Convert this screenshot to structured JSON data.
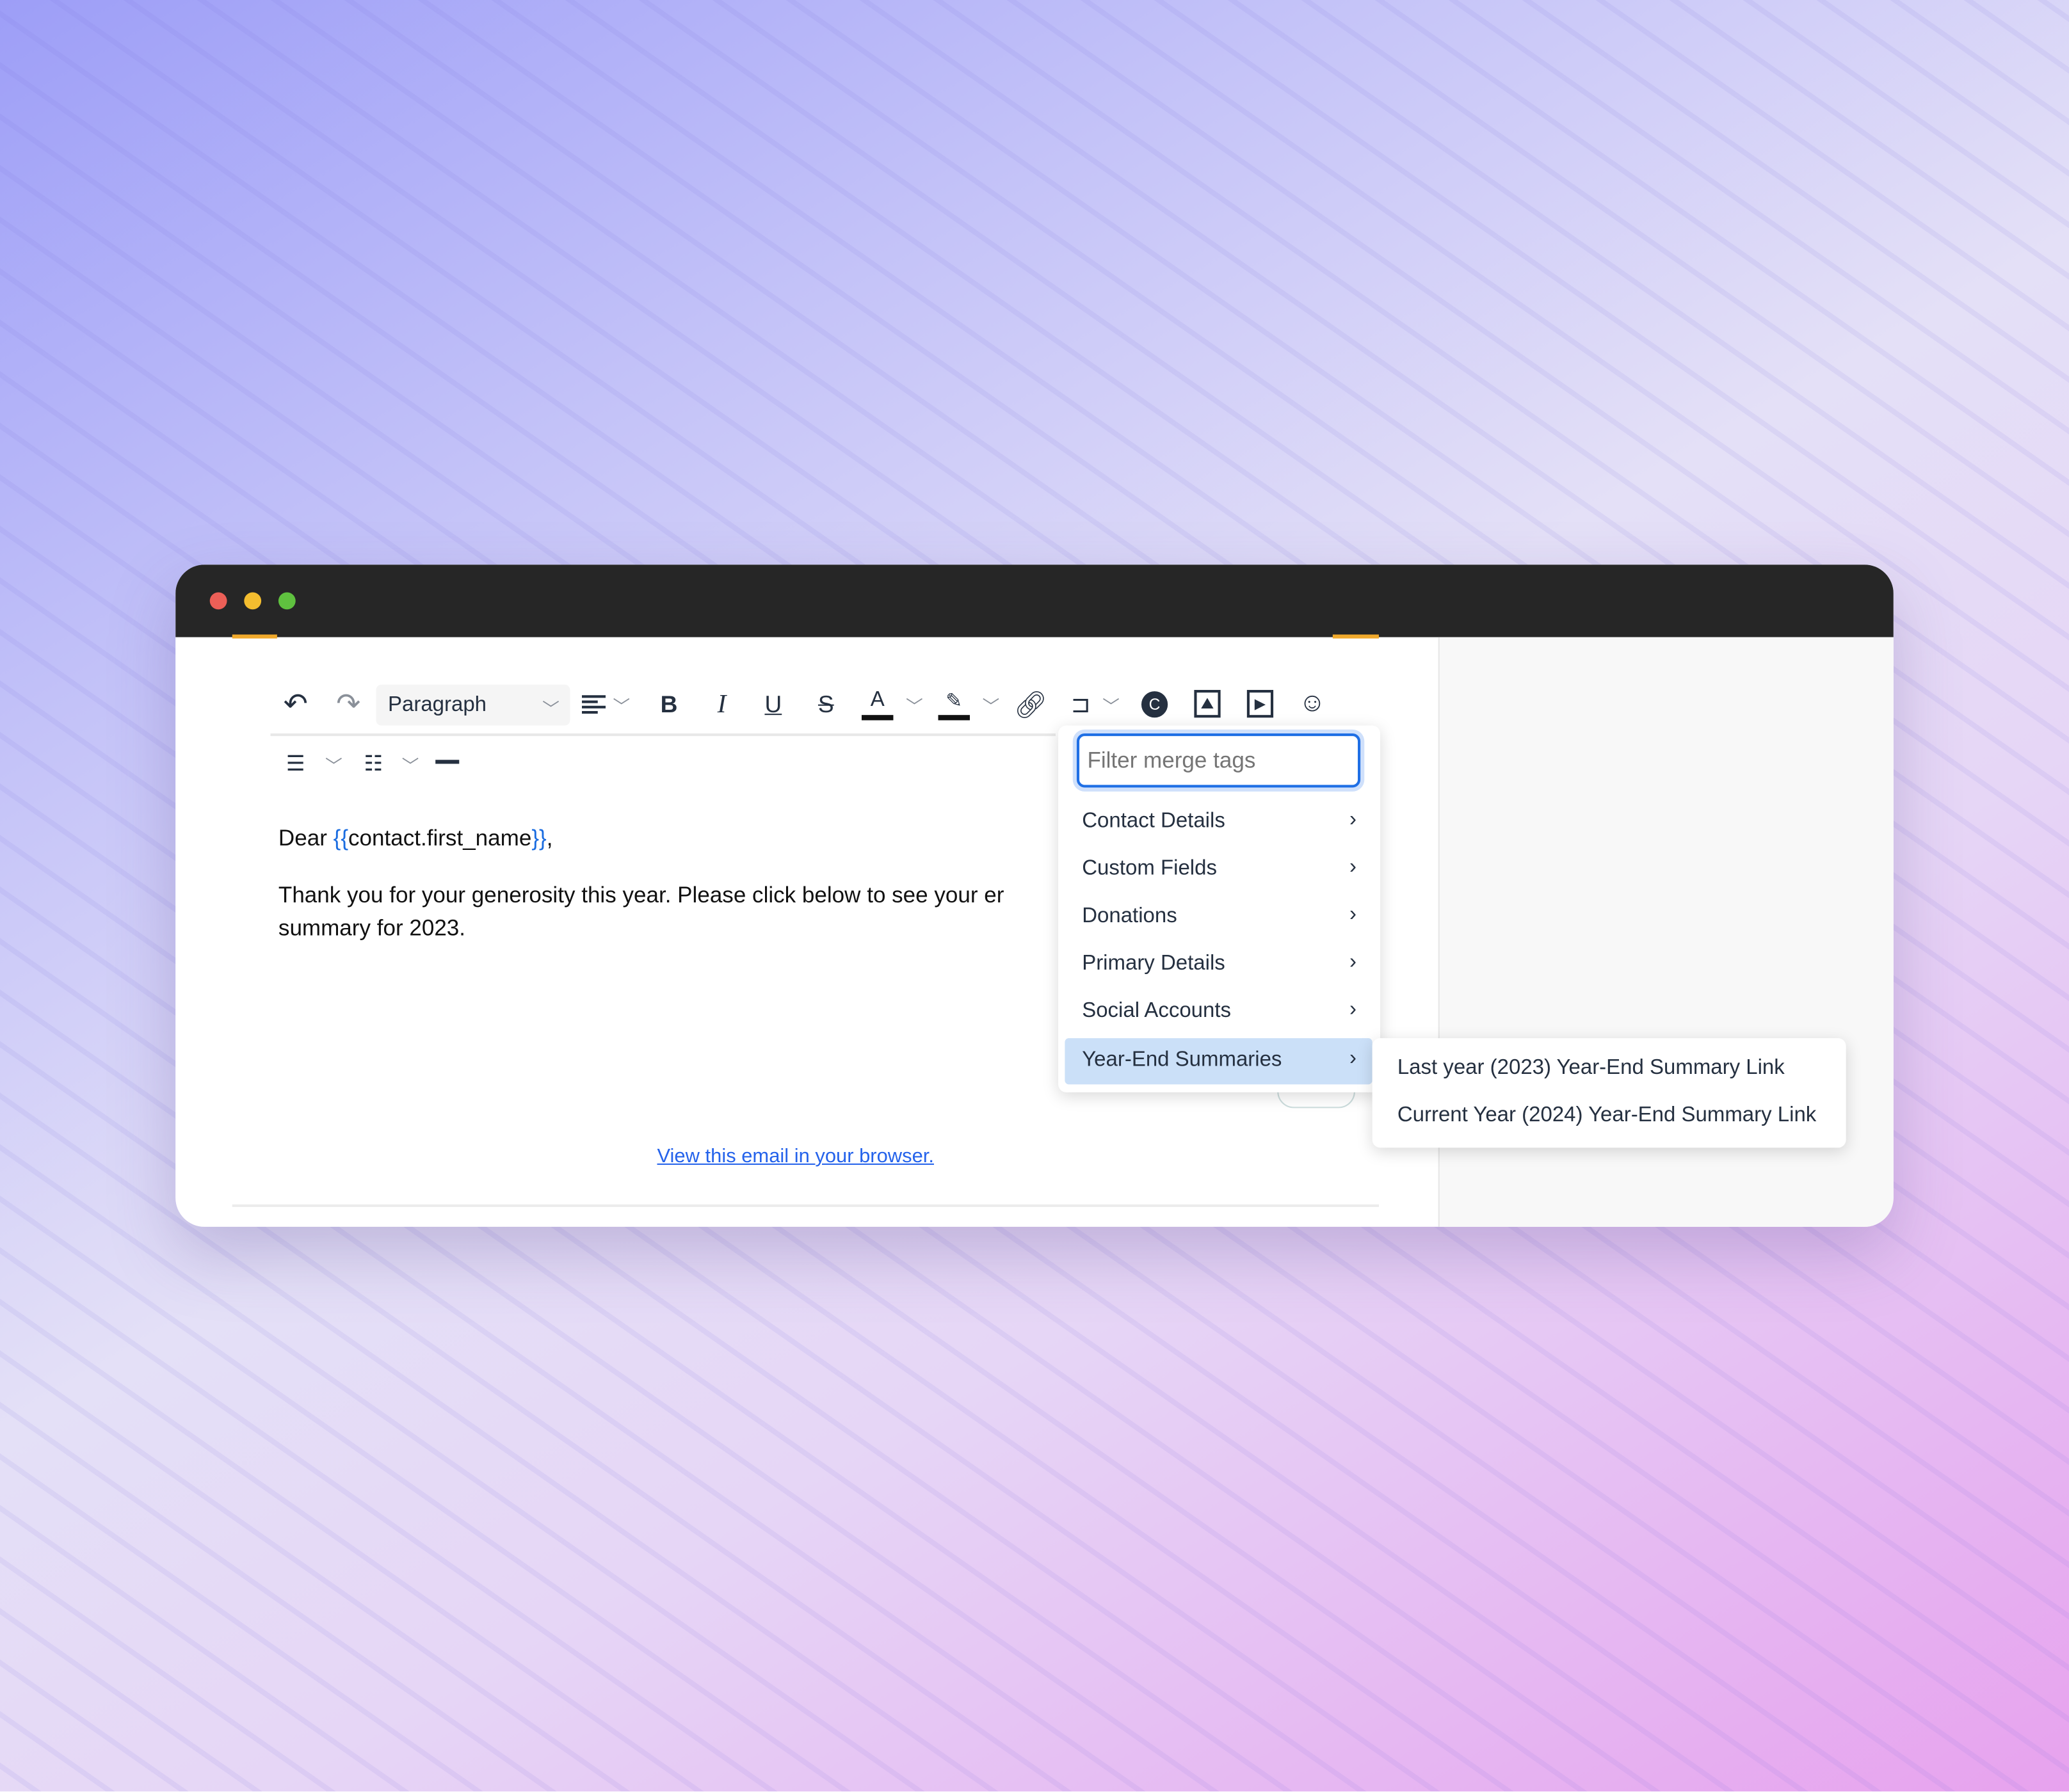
{
  "window": {
    "dot_colors": [
      "#ec5f57",
      "#f4bd2f",
      "#5fc13f"
    ],
    "accent": "#f0a92b"
  },
  "toolbar": {
    "undo": "↶",
    "redo": "↷",
    "block_format": "Paragraph",
    "icons": [
      "undo-icon",
      "redo-icon",
      "align-icon",
      "bold-icon",
      "italic-icon",
      "underline-icon",
      "strikethrough-icon",
      "text-color-icon",
      "highlight-icon",
      "link-icon",
      "merge-tag-icon",
      "copyright-icon",
      "image-icon",
      "video-icon",
      "emoji-icon",
      "numbered-list-icon",
      "bulleted-list-icon",
      "horizontal-rule-icon"
    ]
  },
  "editor": {
    "greeting_prefix": "Dear ",
    "merge_open": "{{",
    "merge_field": "contact.first_name",
    "merge_close": "}}",
    "greeting_suffix": ",",
    "line1": "Thank you for your generosity this year. Please click below to see your er",
    "line2": "summary for 2023.",
    "view_in_browser": "View this email in your browser."
  },
  "merge_menu": {
    "filter_placeholder": "Filter merge tags",
    "items": [
      {
        "label": "Contact Details"
      },
      {
        "label": "Custom Fields"
      },
      {
        "label": "Donations"
      },
      {
        "label": "Primary Details"
      },
      {
        "label": "Social Accounts"
      },
      {
        "label": "Year-End Summaries",
        "active": true
      }
    ],
    "submenu": [
      {
        "label": "Last year (2023) Year-End Summary Link"
      },
      {
        "label": "Current Year (2024) Year-End Summary Link"
      }
    ]
  }
}
